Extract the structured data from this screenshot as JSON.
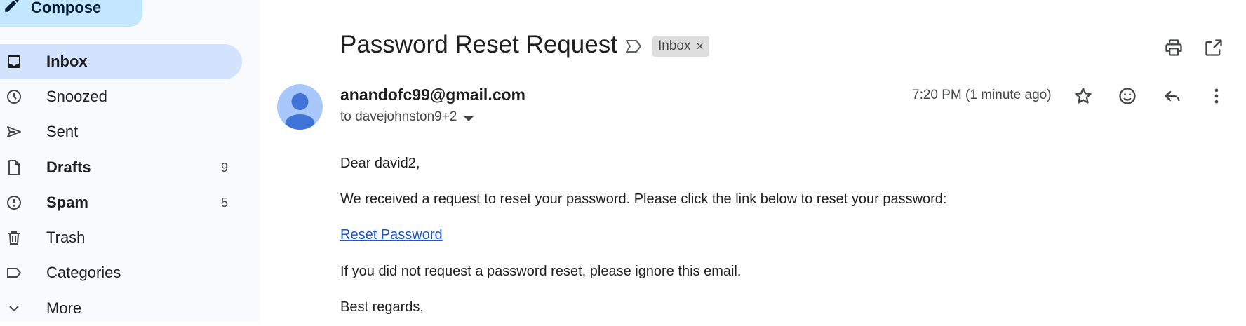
{
  "sidebar": {
    "compose_label": "Compose",
    "items": [
      {
        "label": "Inbox",
        "count": "",
        "icon": "inbox-icon"
      },
      {
        "label": "Snoozed",
        "count": "",
        "icon": "clock-icon"
      },
      {
        "label": "Sent",
        "count": "",
        "icon": "send-icon"
      },
      {
        "label": "Drafts",
        "count": "9",
        "icon": "draft-file-icon"
      },
      {
        "label": "Spam",
        "count": "5",
        "icon": "spam-icon"
      },
      {
        "label": "Trash",
        "count": "",
        "icon": "trash-icon"
      },
      {
        "label": "Categories",
        "count": "",
        "icon": "label-icon"
      },
      {
        "label": "More",
        "count": "",
        "icon": "chevron-down-icon"
      }
    ]
  },
  "message": {
    "subject": "Password Reset Request",
    "label_chip": "Inbox",
    "chip_close": "×",
    "sender": "anandofc99@gmail.com",
    "to": "to davejohnston9+2",
    "time": "7:20 PM (1 minute ago)",
    "body": {
      "greeting": "Dear david2,",
      "line1": "We received a request to reset your password. Please click the link below to reset your password:",
      "link": "Reset Password",
      "line2": "If you did not request a password reset, please ignore this email.",
      "closing": "Best regards,"
    }
  },
  "colors": {
    "accent": "#d3e3fd",
    "compose": "#c2e7ff",
    "link": "#1a56c7",
    "avatar": "#a8c7fa"
  }
}
